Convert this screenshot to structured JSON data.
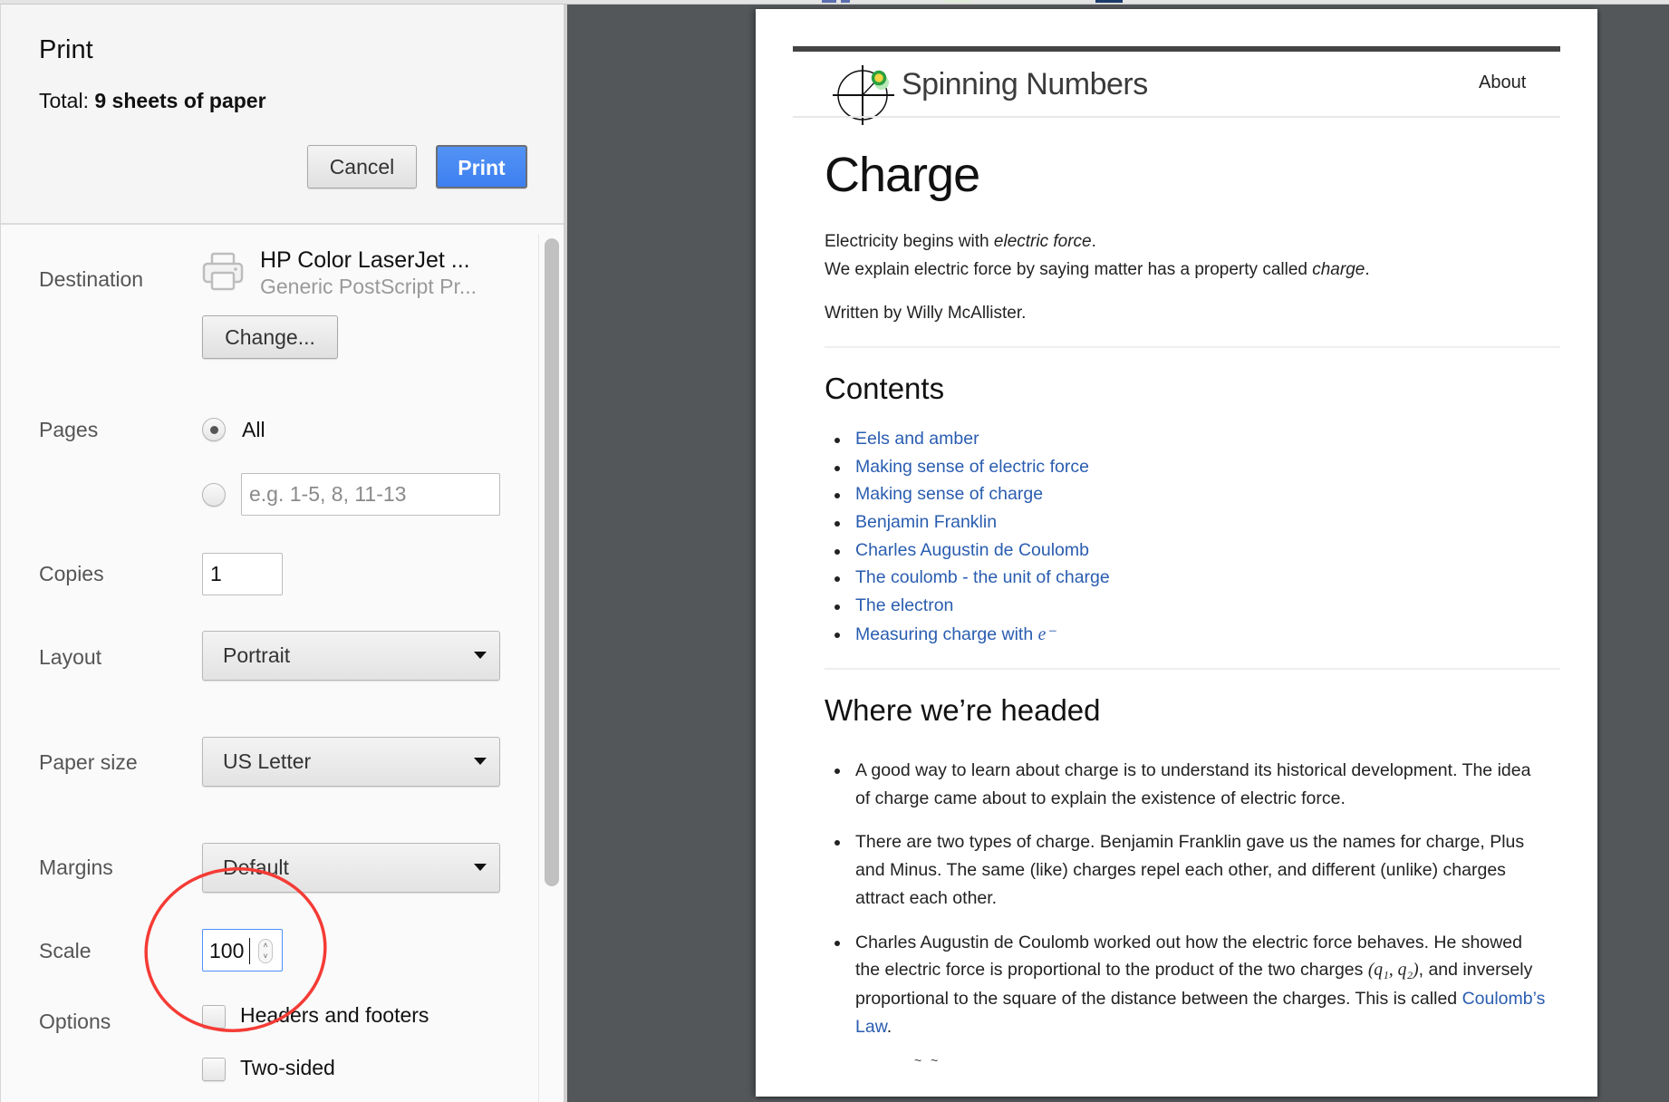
{
  "dialog": {
    "title": "Print",
    "total_prefix": "Total:",
    "total_value": "9 sheets of paper",
    "cancel_label": "Cancel",
    "print_label": "Print",
    "accent_color": "#4285f4"
  },
  "settings": {
    "destination": {
      "label": "Destination",
      "icon": "printer-icon",
      "printer_name": "HP Color LaserJet ...",
      "printer_subtitle": "Generic PostScript Pr...",
      "change_label": "Change..."
    },
    "pages": {
      "label": "Pages",
      "option_all": "All",
      "selected": "All",
      "custom_placeholder": "e.g. 1-5, 8, 11-13",
      "custom_value": ""
    },
    "copies": {
      "label": "Copies",
      "value": "1"
    },
    "layout": {
      "label": "Layout",
      "value": "Portrait"
    },
    "paper_size": {
      "label": "Paper size",
      "value": "US Letter"
    },
    "margins": {
      "label": "Margins",
      "value": "Default"
    },
    "scale": {
      "label": "Scale",
      "value": "100"
    },
    "options": {
      "label": "Options",
      "headers_footers": {
        "label": "Headers and footers",
        "checked": false
      },
      "two_sided": {
        "label": "Two-sided",
        "checked": false
      }
    }
  },
  "annotation": {
    "shape": "ellipse",
    "color": "#ff3b30",
    "target": "scale-input"
  },
  "preview": {
    "site_name": "Spinning Numbers",
    "nav_about": "About",
    "title": "Charge",
    "intro_1_prefix": "Electricity begins with ",
    "intro_1_em": "electric force",
    "intro_1_suffix": ".",
    "intro_2_prefix": "We explain electric force by saying matter has a property called ",
    "intro_2_em": "charge",
    "intro_2_suffix": ".",
    "author": "Written by Willy McAllister.",
    "contents_heading": "Contents",
    "toc": [
      "Eels and amber",
      "Making sense of electric force",
      "Making sense of charge",
      "Benjamin Franklin",
      "Charles Augustin de Coulomb",
      "The coulomb - the unit of charge",
      "The electron",
      "Measuring charge with "
    ],
    "toc_last_math": "e⁻",
    "headed_heading": "Where we’re headed",
    "bullets": {
      "b1": "A good way to learn about charge is to understand its historical development. The idea of charge came about to explain the existence of electric force.",
      "b2": "There are two types of charge. Benjamin Franklin gave us the names for charge, Plus and Minus. The same (like) charges repel each other, and different (unlike) charges attract each other.",
      "b3_prefix": "Charles Augustin de Coulomb worked out how the electric force behaves. He showed the electric force is proportional to the product of the two charges ",
      "b3_math": "(q₁, q₂)",
      "b3_middle": ", and inversely proportional to the square of the distance between the charges. This is called ",
      "b3_link": "Coulomb’s Law",
      "b3_suffix": "."
    },
    "link_color": "#2a5db0"
  }
}
